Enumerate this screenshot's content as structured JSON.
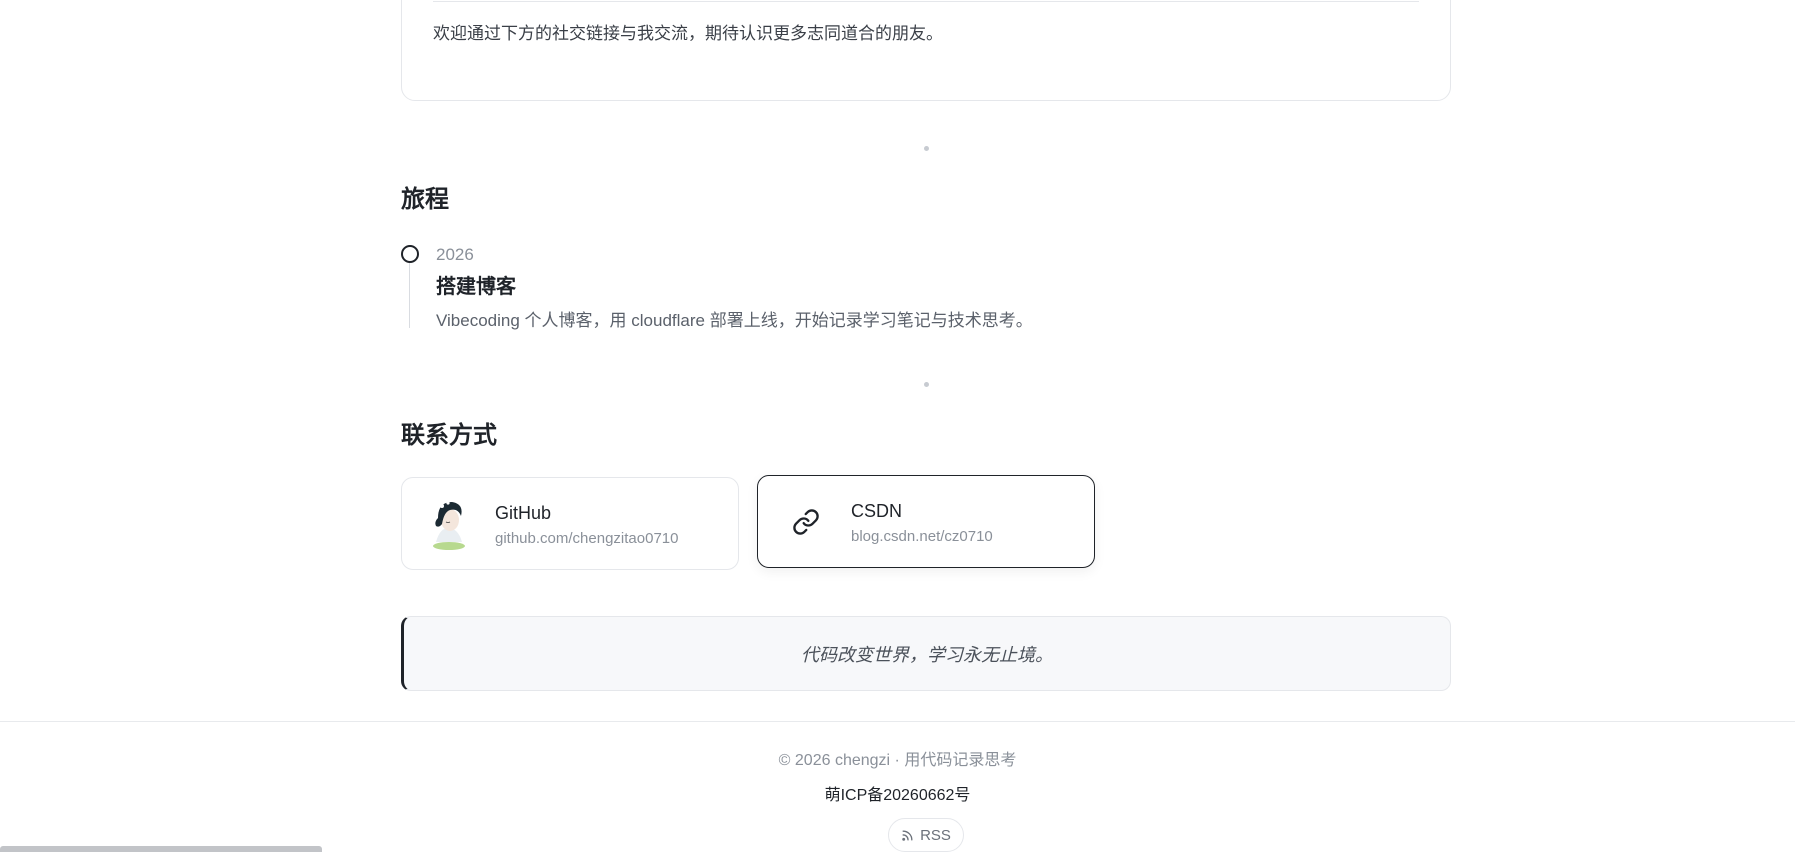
{
  "intro": {
    "text": "欢迎通过下方的社交链接与我交流，期待认识更多志同道合的朋友。"
  },
  "journey": {
    "title": "旅程",
    "items": [
      {
        "year": "2026",
        "title": "搭建博客",
        "description": "Vibecoding 个人博客，用 cloudflare 部署上线，开始记录学习笔记与技术思考。"
      }
    ]
  },
  "contact": {
    "title": "联系方式",
    "cards": [
      {
        "name": "GitHub",
        "url": "github.com/chengzitao0710",
        "icon": "avatar"
      },
      {
        "name": "CSDN",
        "url": "blog.csdn.net/cz0710",
        "icon": "link-icon"
      }
    ]
  },
  "quote": {
    "text": "代码改变世界，学习永无止境。"
  },
  "footer": {
    "copyright": "© 2026 chengzi · 用代码记录思考",
    "icp": "萌ICP备20260662号",
    "rss_label": "RSS"
  },
  "colors": {
    "text": "#1f2329",
    "muted": "#8a9099",
    "border": "#e5e7eb",
    "quote_bg": "#f7f8fa"
  }
}
